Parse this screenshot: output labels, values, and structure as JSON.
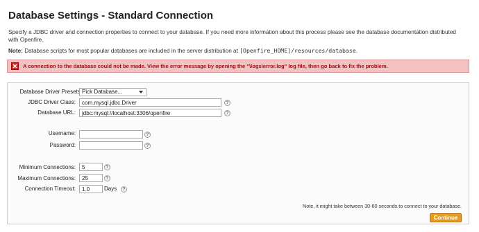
{
  "page": {
    "title": "Database Settings - Standard Connection",
    "intro": "Specify a JDBC driver and connection properties to connect to your database. If you need more information about this process please see the database documentation distributed with Openfire.",
    "note_label": "Note:",
    "note_text": " Database scripts for most popular databases are included in the server distribution at ",
    "note_path": "[Openfire_HOME]/resources/database",
    "note_end": "."
  },
  "error": {
    "icon": "error-x-icon",
    "message": "A connection to the database could not be made. View the error message by opening the \"\\logs\\error.log\" log file, then go back to fix the problem.",
    "color": "#9a1010",
    "background": "#f2c2c2"
  },
  "form": {
    "presets": {
      "label": "Database Driver Presets:",
      "value": "Pick Database..."
    },
    "driver_class": {
      "label": "JDBC Driver Class:",
      "value": "com.mysql.jdbc.Driver"
    },
    "db_url": {
      "label": "Database URL:",
      "value": "jdbc:mysql://localhost:3306/openfire"
    },
    "username": {
      "label": "Username:",
      "value": ""
    },
    "password": {
      "label": "Password:",
      "value": ""
    },
    "min_connections": {
      "label": "Minimum Connections:",
      "value": "5"
    },
    "max_connections": {
      "label": "Maximum Connections:",
      "value": "25"
    },
    "timeout": {
      "label": "Connection Timeout:",
      "value": "1.0",
      "unit": "Days"
    },
    "help_icon": "help-icon",
    "footnote": "Note, it might take between 30-60 seconds to connect to your database.",
    "continue_label": "Continue",
    "accent": "#e89b1c"
  }
}
